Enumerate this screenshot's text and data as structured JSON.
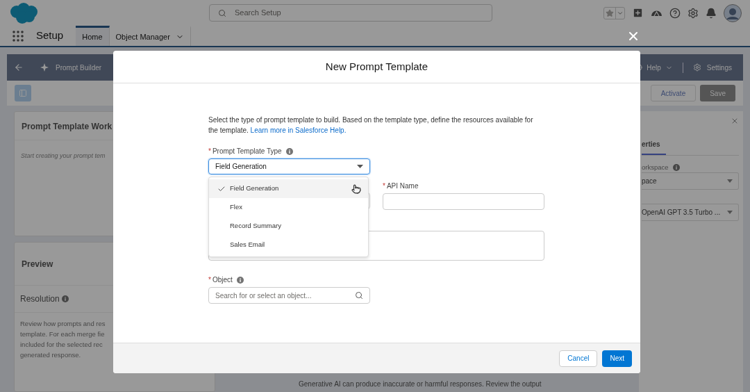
{
  "header": {
    "search_placeholder": "Search Setup"
  },
  "nav": {
    "app_name": "Setup",
    "tabs": [
      {
        "label": "Home",
        "selected": true,
        "has_menu": false
      },
      {
        "label": "Object Manager",
        "selected": false,
        "has_menu": true
      }
    ]
  },
  "builder_bar": {
    "title": "Prompt Builder",
    "help": "Help",
    "settings": "Settings"
  },
  "toolbar": {
    "buttons": [
      {
        "label": "Activate",
        "kind": "outline"
      },
      {
        "label": "Save",
        "kind": "filled"
      }
    ]
  },
  "workspace_panel": {
    "title": "Prompt Template Work",
    "placeholder": "Start creating your prompt tem"
  },
  "preview_panel": {
    "title": "Preview",
    "section": "Resolution",
    "description_lines": [
      "Review how prompts and res",
      "template. For each merge fie",
      "included for the selected rec",
      "generated response."
    ]
  },
  "properties_panel": {
    "tab": "erties",
    "fields": [
      {
        "label": "orkspace",
        "info": true,
        "value": "pace"
      },
      {
        "value": "OpenAI GPT 3.5 Turbo ..."
      }
    ]
  },
  "disclaimer": "Generative AI can produce inaccurate or harmful responses. Review the output",
  "modal": {
    "title": "New Prompt Template",
    "intro": "Select the type of prompt template to build. Based on the template type, define the resources available for the template.",
    "help_link": "Learn more in Salesforce Help.",
    "type_field": {
      "label": "Prompt Template Type",
      "required_mark": "*",
      "info": true,
      "value": "Field Generation",
      "options": [
        {
          "label": "Field Generation",
          "selected": true,
          "hovered": true
        },
        {
          "label": "Flex",
          "selected": false,
          "hovered": false
        },
        {
          "label": "Record Summary",
          "selected": false,
          "hovered": false
        },
        {
          "label": "Sales Email",
          "selected": false,
          "hovered": false
        }
      ]
    },
    "api_name_field": {
      "label": "API Name",
      "required_mark": "*"
    },
    "object_field": {
      "label": "Object",
      "required_mark": "*",
      "info": true,
      "placeholder": "Search for or select an object..."
    },
    "buttons": [
      {
        "label": "Cancel",
        "kind": "neutral"
      },
      {
        "label": "Next",
        "kind": "brand"
      }
    ]
  }
}
